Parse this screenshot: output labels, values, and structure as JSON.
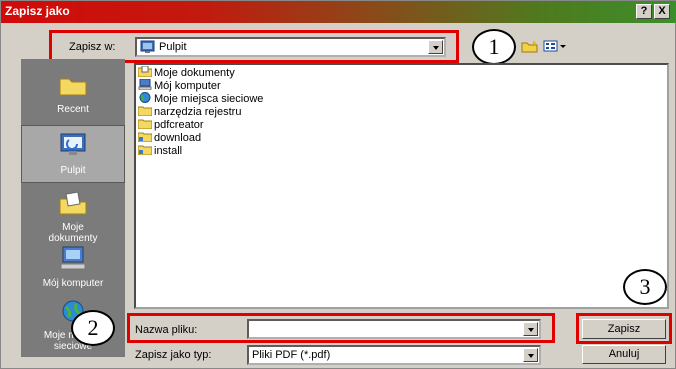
{
  "window": {
    "title": "Zapisz jako",
    "help_glyph": "?",
    "close_glyph": "X"
  },
  "location": {
    "label": "Zapisz w:",
    "value": "Pulpit"
  },
  "places": [
    {
      "label": "Recent",
      "icon": "recent-folder-icon"
    },
    {
      "label": "Pulpit",
      "icon": "desktop-icon",
      "selected": true
    },
    {
      "label": "Moje\ndokumenty",
      "icon": "my-documents-icon"
    },
    {
      "label": "Mój komputer",
      "icon": "my-computer-icon"
    },
    {
      "label": "Moje miejsca sieciowe",
      "icon": "network-places-icon"
    }
  ],
  "files": [
    {
      "name": "Moje dokumenty",
      "icon": "my-documents-icon"
    },
    {
      "name": "Mój komputer",
      "icon": "my-computer-icon"
    },
    {
      "name": "Moje miejsca sieciowe",
      "icon": "network-icon"
    },
    {
      "name": "narzędzia rejestru",
      "icon": "folder-icon"
    },
    {
      "name": "pdfcreator",
      "icon": "folder-icon"
    },
    {
      "name": "download",
      "icon": "shared-folder-icon"
    },
    {
      "name": "install",
      "icon": "shared-folder-icon"
    }
  ],
  "filename": {
    "label": "Nazwa pliku:",
    "value": ""
  },
  "filetype": {
    "label": "Zapisz jako typ:",
    "value": "Pliki PDF (*.pdf)"
  },
  "buttons": {
    "save": "Zapisz",
    "cancel": "Anuluj"
  },
  "markers": [
    "1",
    "2",
    "3"
  ],
  "colors": {
    "highlight": "#e00000",
    "places_bg": "#7b7b7b"
  }
}
